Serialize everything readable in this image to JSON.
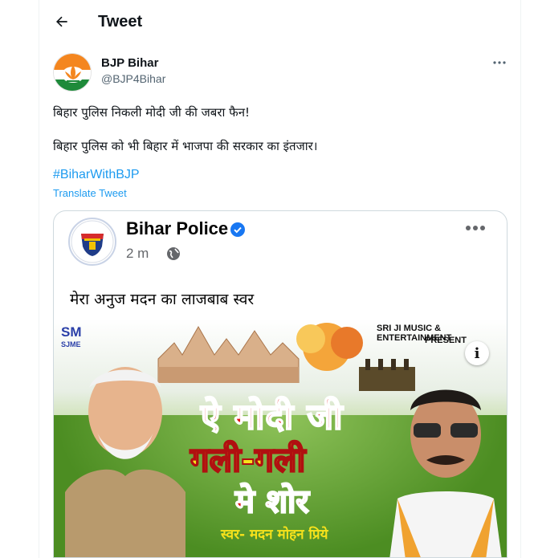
{
  "header": {
    "title": "Tweet",
    "back_icon": "arrow-left-icon"
  },
  "tweet": {
    "author_name": "BJP Bihar",
    "author_handle": "@BJP4Bihar",
    "text_line_1": "बिहार पुलिस निकली मोदी जी की जबरा फैन!",
    "text_line_2": "बिहार पुलिस को भी बिहार में भाजपा की सरकार का इंतजार।",
    "hashtag": "#BiharWithBJP",
    "translate_label": "Translate Tweet"
  },
  "embedded_post": {
    "page_name": "Bihar Police",
    "time": "2 m",
    "caption": "मेरा अनुज मदन का लाजबाब स्वर",
    "poster": {
      "brand_short": "SM",
      "brand_sub": "SJME",
      "label_company": "SRI JI MUSIC & ENTERTAINMENT",
      "label_present": "PRESENT",
      "title_line_1": "ऐ मोदी जी",
      "title_line_2": "गली-गली",
      "title_line_3": "मे शोर",
      "singer": "स्वर- मदन मोहन प्रिये"
    }
  },
  "colors": {
    "link": "#1d9bf0",
    "muted": "#536471",
    "verified": "#1877f2",
    "poster_red": "#e01818",
    "poster_yellow": "#f7e21b"
  }
}
